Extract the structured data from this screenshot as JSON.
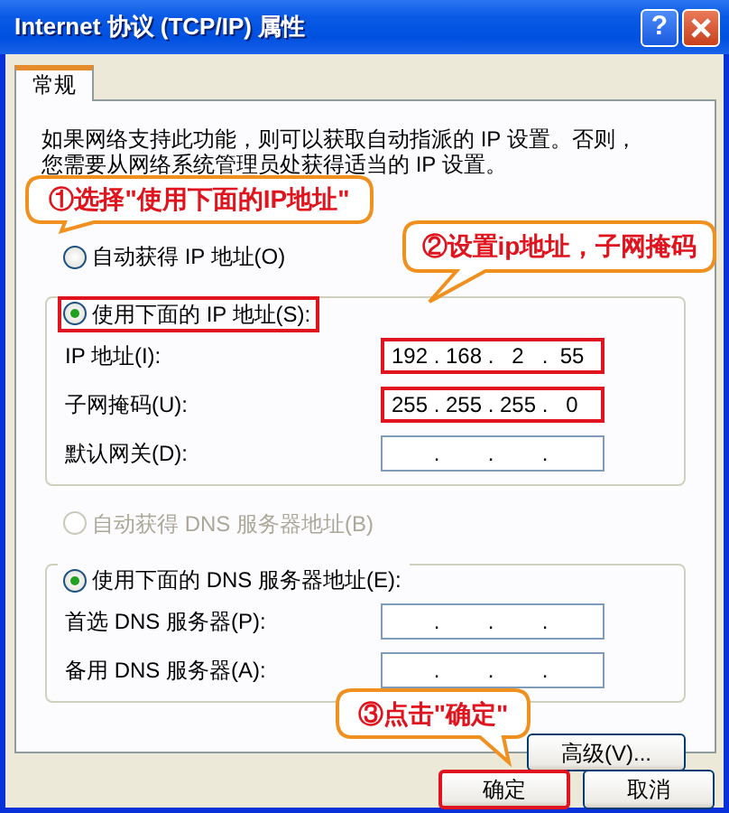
{
  "window": {
    "title": "Internet 协议 (TCP/IP) 属性",
    "help_glyph": "?"
  },
  "tabs": [
    {
      "label": "常规",
      "selected": true
    }
  ],
  "description": [
    "如果网络支持此功能，则可以获取自动指派的 IP 设置。否则，",
    "您需要从网络系统管理员处获得适当的 IP 设置。"
  ],
  "ip_mode": [
    {
      "label": "自动获得 IP 地址(O)",
      "selected": false,
      "highlighted": false
    },
    {
      "label": "使用下面的 IP 地址(S):",
      "selected": true,
      "highlighted": true
    }
  ],
  "ip_fields": [
    {
      "label": "IP 地址(I):",
      "octets": [
        "192",
        "168",
        "2",
        "55"
      ],
      "separator": ".",
      "highlighted": true
    },
    {
      "label": "子网掩码(U):",
      "octets": [
        "255",
        "255",
        "255",
        "0"
      ],
      "separator": ".",
      "highlighted": true
    },
    {
      "label": "默认网关(D):",
      "separator": ".",
      "highlighted": false
    }
  ],
  "dns_mode": [
    {
      "label": "自动获得 DNS 服务器地址(B)",
      "selected": false,
      "disabled": true
    },
    {
      "label": "使用下面的 DNS 服务器地址(E):",
      "selected": true,
      "disabled": false
    }
  ],
  "dns_fields": [
    {
      "label": "首选 DNS 服务器(P):",
      "separator": ".",
      "highlighted": false
    },
    {
      "label": "备用 DNS 服务器(A):",
      "separator": ".",
      "highlighted": false
    }
  ],
  "advanced_button": "高级(V)...",
  "buttons": [
    {
      "label": "确定",
      "highlighted": true
    },
    {
      "label": "取消",
      "highlighted": false
    }
  ],
  "callouts": [
    "①选择\"使用下面的IP地址\"",
    "②设置ip地址，子网掩码",
    "③点击\"确定\""
  ]
}
